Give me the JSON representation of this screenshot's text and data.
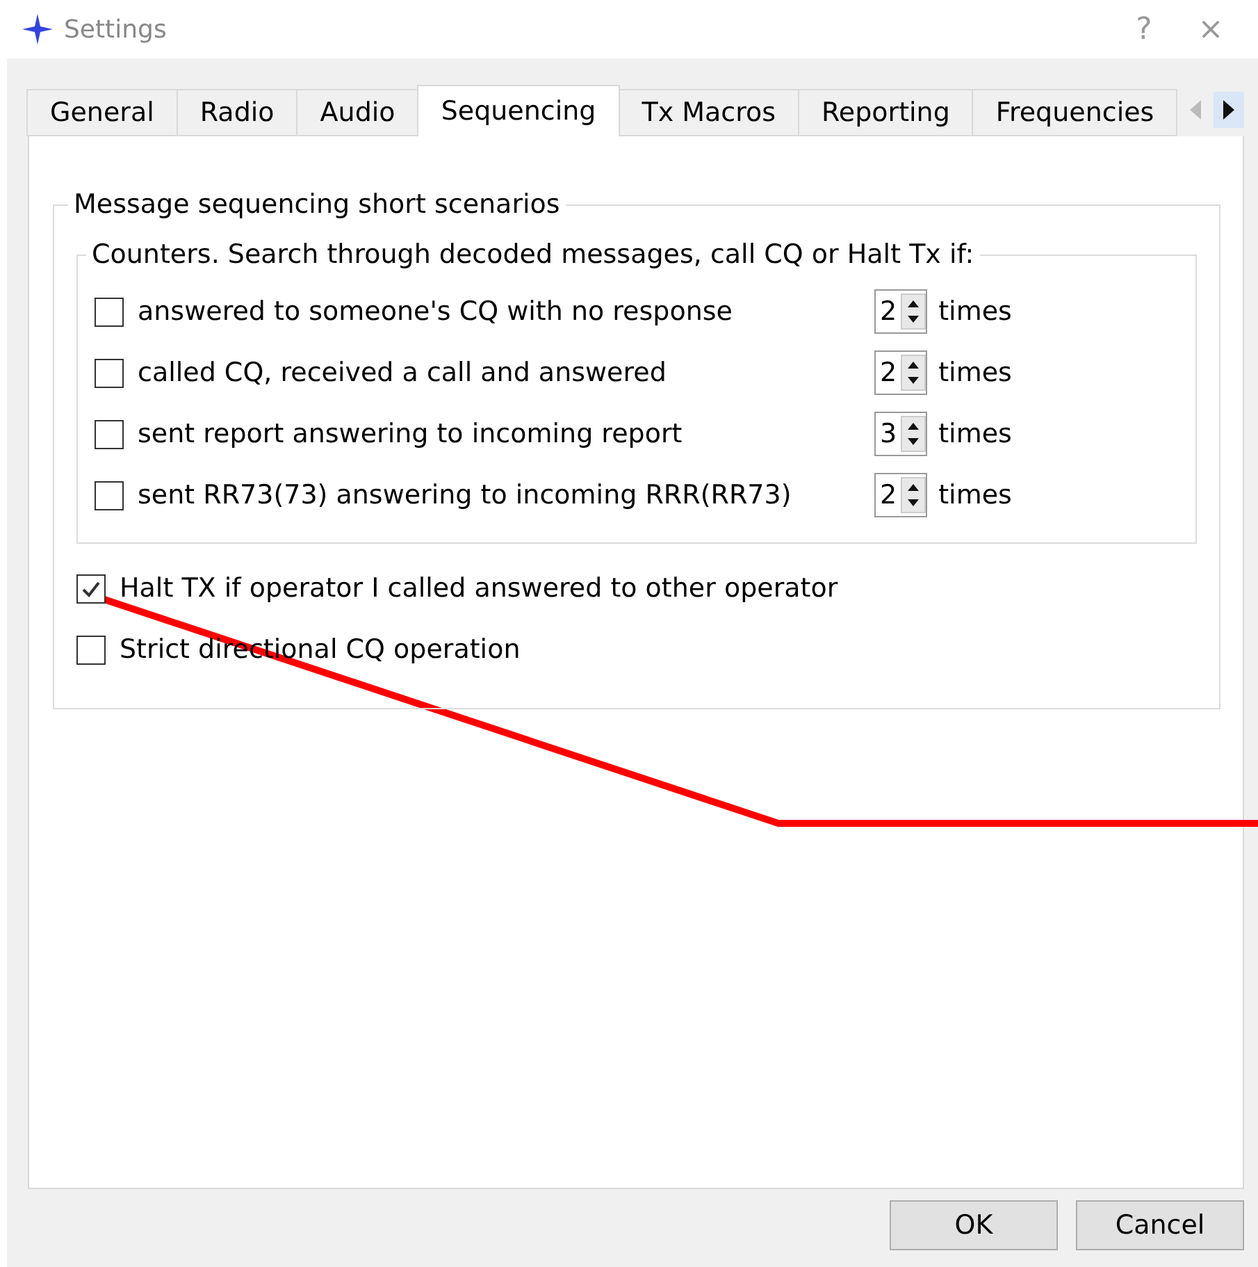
{
  "window": {
    "title": "Settings",
    "help": "?",
    "close": "×"
  },
  "tabs": [
    {
      "label": "General",
      "selected": false
    },
    {
      "label": "Radio",
      "selected": false
    },
    {
      "label": "Audio",
      "selected": false
    },
    {
      "label": "Sequencing",
      "selected": true
    },
    {
      "label": "Tx Macros",
      "selected": false
    },
    {
      "label": "Reporting",
      "selected": false
    },
    {
      "label": "Frequencies",
      "selected": false
    }
  ],
  "group": {
    "title": "Message sequencing short scenarios",
    "counters": {
      "title": "Counters. Search through decoded messages, call CQ or Halt Tx if:",
      "rows": [
        {
          "label": "answered to someone's CQ with no response",
          "checked": false,
          "value": "2",
          "unit": "times"
        },
        {
          "label": "called CQ,  received a call and answered",
          "checked": false,
          "value": "2",
          "unit": "times"
        },
        {
          "label": "sent report answering to incoming report",
          "checked": false,
          "value": "3",
          "unit": "times"
        },
        {
          "label": "sent RR73(73) answering to incoming RRR(RR73)",
          "checked": false,
          "value": "2",
          "unit": "times"
        }
      ]
    },
    "options": [
      {
        "label": "Halt TX if operator I called answered to other operator",
        "checked": true
      },
      {
        "label": "Strict directional CQ operation",
        "checked": false
      }
    ]
  },
  "buttons": [
    "OK",
    "Cancel"
  ]
}
